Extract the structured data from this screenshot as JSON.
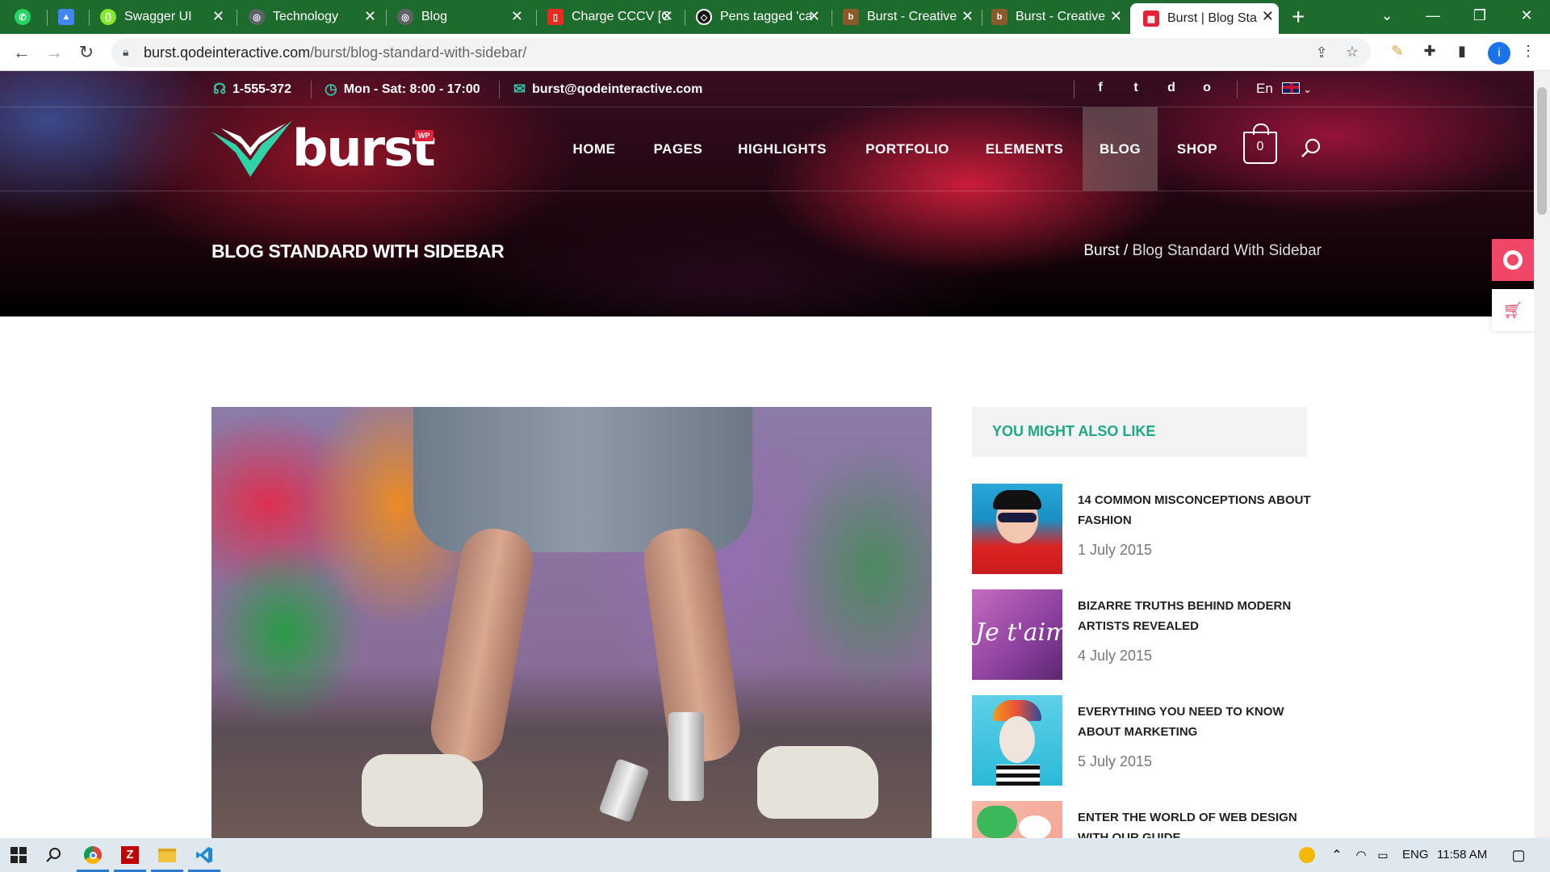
{
  "browser": {
    "tabs": [
      {
        "title": "",
        "fav": "whatsapp-icon",
        "color": "#25d366"
      },
      {
        "title": "",
        "fav": "drive-icon",
        "color": "#4285f4"
      },
      {
        "title": "Swagger UI",
        "fav": "swagger-icon",
        "color": "#85ea2d"
      },
      {
        "title": "Technology",
        "fav": "globe-icon",
        "color": "#5f6368"
      },
      {
        "title": "Blog",
        "fav": "globe-icon",
        "color": "#5f6368"
      },
      {
        "title": "Charge CCCV [C",
        "fav": "pdf-icon",
        "color": "#e62b1e"
      },
      {
        "title": "Pens tagged 'ca",
        "fav": "codepen-icon",
        "color": "#111111"
      },
      {
        "title": "Burst - Creative",
        "fav": "burst-icon",
        "color": "#8a5a2b"
      },
      {
        "title": "Burst - Creative",
        "fav": "burst-icon",
        "color": "#8a5a2b"
      },
      {
        "title": "Burst | Blog Sta",
        "fav": "qode-icon",
        "color": "#e0233a"
      }
    ],
    "new_tab": "+",
    "url_domain": "burst.qodeinteractive.com",
    "url_path": "/burst/blog-standard-with-sidebar/",
    "profile_initial": "i"
  },
  "topbar": {
    "phone": "1-555-372",
    "hours": "Mon - Sat: 8:00 - 17:00",
    "email": "burst@qodeinteractive.com",
    "social": [
      "f",
      "t",
      "d",
      "o"
    ],
    "lang": "En"
  },
  "logo": {
    "word": "burst",
    "badge": "WP"
  },
  "nav": [
    {
      "label": "HOME"
    },
    {
      "label": "PAGES"
    },
    {
      "label": "HIGHLIGHTS"
    },
    {
      "label": "PORTFOLIO"
    },
    {
      "label": "ELEMENTS"
    },
    {
      "label": "BLOG",
      "active": true
    },
    {
      "label": "SHOP"
    }
  ],
  "cart_count": "0",
  "page_title": "BLOG STANDARD WITH SIDEBAR",
  "breadcrumb": {
    "home": "Burst",
    "sep": " / ",
    "current": "Blog Standard With Sidebar"
  },
  "sidebar": {
    "title": "YOU MIGHT ALSO LIKE",
    "posts": [
      {
        "title": "14 COMMON MISCONCEPTIONS ABOUT FASHION",
        "date": "1 July 2015"
      },
      {
        "title": "BIZARRE TRUTHS BEHIND MODERN ARTISTS REVEALED",
        "date": "4 July 2015"
      },
      {
        "title": "EVERYTHING YOU NEED TO KNOW ABOUT MARKETING",
        "date": "5 July 2015"
      },
      {
        "title": "ENTER THE WORLD OF WEB DESIGN WITH OUR GUIDE",
        "date": ""
      }
    ]
  },
  "thumb_text": "Je t'aime",
  "taskbar": {
    "lang": "ENG",
    "time": "11:58 AM"
  },
  "colors": {
    "accent": "#1ea885",
    "brand_red": "#e0233a",
    "chrome": "#1e6b2e"
  }
}
